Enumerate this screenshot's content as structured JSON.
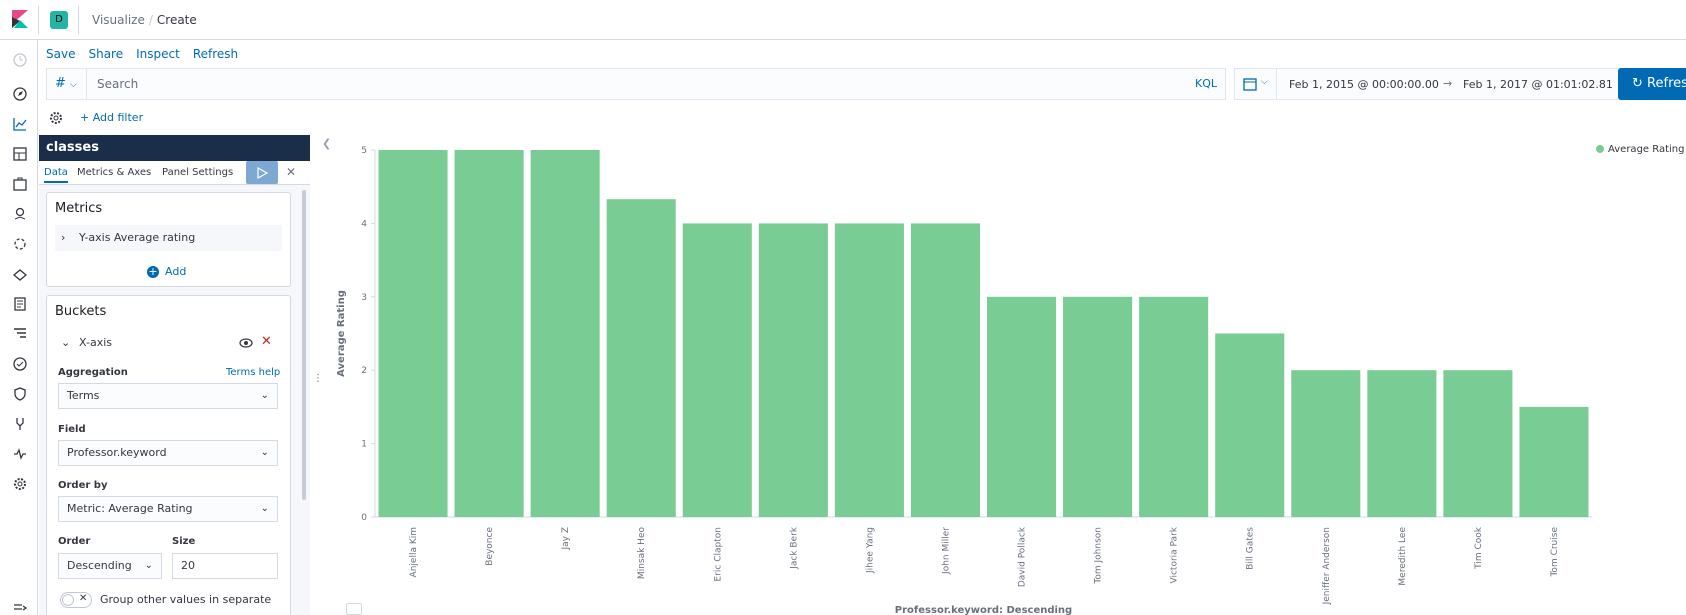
{
  "header": {
    "space_initial": "D",
    "breadcrumbs": [
      "Visualize",
      "Create"
    ]
  },
  "topmenu": [
    "Save",
    "Share",
    "Inspect",
    "Refresh"
  ],
  "query": {
    "lang_symbol": "#",
    "placeholder": "Search",
    "kql_label": "KQL"
  },
  "date_range": {
    "start": "Feb 1, 2015 @ 00:00:00.00",
    "arrow": "→",
    "end": "Feb 1, 2017 @ 01:01:02.81"
  },
  "refresh_button": "Refresh",
  "filter": {
    "add_label": "+ Add filter"
  },
  "sidebar": {
    "title": "classes",
    "tabs": [
      "Data",
      "Metrics & Axes",
      "Panel Settings"
    ],
    "metrics": {
      "title": "Metrics",
      "item": "Y-axis Average rating",
      "add_label": "Add"
    },
    "buckets": {
      "title": "Buckets",
      "item": "X-axis",
      "aggregation_label": "Aggregation",
      "terms_help": "Terms help",
      "aggregation_value": "Terms",
      "field_label": "Field",
      "field_value": "Professor.keyword",
      "order_by_label": "Order by",
      "order_by_value": "Metric: Average Rating",
      "order_label": "Order",
      "order_value": "Descending",
      "size_label": "Size",
      "size_value": "20",
      "group_other_label": "Group other values in separate"
    }
  },
  "colors": {
    "bar": "#7acc95",
    "accent": "#006bb4",
    "sidebar_title_bg": "#1a2e4a"
  },
  "chart_data": {
    "type": "bar",
    "categories": [
      "Anjella Kim",
      "Beyonce",
      "Jay Z",
      "Minsak Heo",
      "Eric Clapton",
      "Jack Berk",
      "Jihee Yang",
      "John Miller",
      "David Pollack",
      "Tom Johnson",
      "Victoria Park",
      "Bill Gates",
      "Jeniffer Anderson",
      "Meredith Lee",
      "Tim Cook",
      "Tom Cruise"
    ],
    "series": [
      {
        "name": "Average Rating",
        "values": [
          5,
          5,
          5,
          4.33,
          4,
          4,
          4,
          4,
          3,
          3,
          3,
          2.5,
          2,
          2,
          2,
          1.5
        ]
      }
    ],
    "xlabel": "Professor.keyword: Descending",
    "ylabel": "Average Rating",
    "ylim": [
      0,
      5
    ],
    "yticks": [
      0,
      1,
      2,
      3,
      4,
      5
    ],
    "legend_position": "top-right",
    "grid": false
  }
}
